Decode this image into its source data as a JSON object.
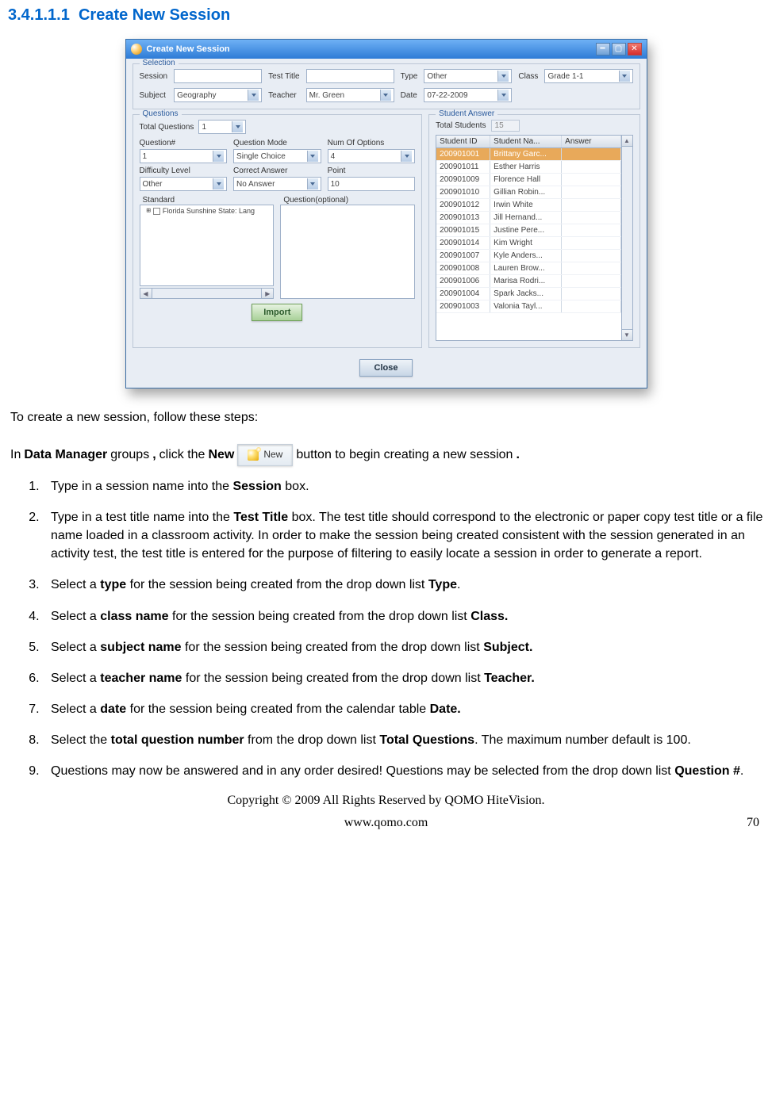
{
  "heading": {
    "num": "3.4.1.1.1",
    "title": "Create New Session"
  },
  "dialog": {
    "title": "Create New Session",
    "selection": {
      "legend": "Selection",
      "session_label": "Session",
      "session_value": "",
      "testtitle_label": "Test Title",
      "testtitle_value": "",
      "type_label": "Type",
      "type_value": "Other",
      "class_label": "Class",
      "class_value": "Grade 1-1",
      "subject_label": "Subject",
      "subject_value": "Geography",
      "teacher_label": "Teacher",
      "teacher_value": "Mr. Green",
      "date_label": "Date",
      "date_value": "07-22-2009"
    },
    "questions": {
      "legend": "Questions",
      "total_label": "Total Questions",
      "total_value": "1",
      "qnum_label": "Question#",
      "qnum_value": "1",
      "mode_label": "Question Mode",
      "mode_value": "Single Choice",
      "numopt_label": "Num Of Options",
      "numopt_value": "4",
      "diff_label": "Difficulty Level",
      "diff_value": "Other",
      "correct_label": "Correct Answer",
      "correct_value": "No Answer",
      "point_label": "Point",
      "point_value": "10",
      "standard_label": "Standard",
      "standard_item": "Florida Sunshine State: Lang",
      "qopt_label": "Question(optional)",
      "import_label": "Import"
    },
    "student_answer": {
      "legend": "Student Answer",
      "total_label": "Total Students",
      "total_value": "15",
      "col_id": "Student ID",
      "col_name": "Student Na...",
      "col_answer": "Answer",
      "rows": [
        {
          "id": "200901001",
          "name": "Brittany Garc...",
          "answer": "",
          "selected": true
        },
        {
          "id": "200901011",
          "name": "Esther Harris",
          "answer": ""
        },
        {
          "id": "200901009",
          "name": "Florence Hall",
          "answer": ""
        },
        {
          "id": "200901010",
          "name": "Gillian Robin...",
          "answer": ""
        },
        {
          "id": "200901012",
          "name": "Irwin White",
          "answer": ""
        },
        {
          "id": "200901013",
          "name": "Jill  Hernand...",
          "answer": ""
        },
        {
          "id": "200901015",
          "name": "Justine Pere...",
          "answer": ""
        },
        {
          "id": "200901014",
          "name": "Kim Wright",
          "answer": ""
        },
        {
          "id": "200901007",
          "name": "Kyle Anders...",
          "answer": ""
        },
        {
          "id": "200901008",
          "name": "Lauren Brow...",
          "answer": ""
        },
        {
          "id": "200901006",
          "name": "Marisa Rodri...",
          "answer": ""
        },
        {
          "id": "200901004",
          "name": "Spark Jacks...",
          "answer": ""
        },
        {
          "id": "200901003",
          "name": "Valonia Tayl...",
          "answer": ""
        }
      ]
    },
    "close_label": "Close"
  },
  "new_button_label": "New",
  "intro": "To create a new session, follow these steps:",
  "inline": {
    "p1": "In ",
    "b1": "Data Manager",
    "p2": " groups",
    "b2": ",",
    "p3": " click the ",
    "b3": "New",
    "p4": " button to begin creating a new session",
    "b4": "."
  },
  "steps": [
    {
      "pre": "Type in a session name into the ",
      "b": [
        "Session"
      ],
      "post": " box."
    },
    {
      "pre": "Type in a test title name into the ",
      "b": [
        "Test Title"
      ],
      "post": " box. The test title should correspond to the electronic or paper copy test title or a file name loaded in a classroom activity. In order to make the session being created consistent with the session generated in an activity test, the test title is entered for the purpose of filtering to easily locate a session in order to generate a report."
    },
    {
      "pre": "Select a ",
      "b": [
        "type"
      ],
      "mid": " for the session being created from the drop down list ",
      "b2": [
        "Type"
      ],
      "post": "."
    },
    {
      "pre": "Select a ",
      "b": [
        "class name"
      ],
      "mid": " for the session being created from the drop down list ",
      "b2": [
        "Class."
      ],
      "post": ""
    },
    {
      "pre": "Select a ",
      "b": [
        "subject name"
      ],
      "mid": " for the session being created from the drop down list ",
      "b2": [
        "Subject."
      ],
      "post": ""
    },
    {
      "pre": "Select a ",
      "b": [
        "teacher name"
      ],
      "mid": " for the session being created from the drop down list ",
      "b2": [
        "Teacher."
      ],
      "post": ""
    },
    {
      "pre": "Select a ",
      "b": [
        "date"
      ],
      "mid": " for the session being created from the calendar table ",
      "b2": [
        "Date."
      ],
      "post": ""
    },
    {
      "pre": "Select the ",
      "b": [
        "total question number"
      ],
      "mid": " from the drop down list ",
      "b2": [
        "Total Questions"
      ],
      "post": ". The maximum number default is 100."
    },
    {
      "pre": "Questions may now be answered and in any order desired! Questions may be selected from the drop down list ",
      "b": [
        "Question #"
      ],
      "post": "."
    }
  ],
  "footer": {
    "copyright": "Copyright © 2009 All Rights Reserved by QOMO HiteVision.",
    "url": "www.qomo.com",
    "page": "70"
  }
}
